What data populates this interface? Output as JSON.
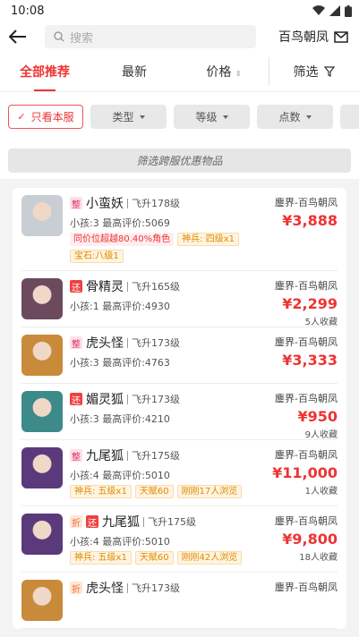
{
  "status": {
    "time": "10:08"
  },
  "header": {
    "search_placeholder": "搜索",
    "server": "百鸟朝凤"
  },
  "tabs": [
    "全部推荐",
    "最新",
    "价格",
    "筛选"
  ],
  "filters": {
    "own_server": "只看本服",
    "dropdowns": [
      "类型",
      "等级",
      "点数"
    ]
  },
  "cross_server": "筛选跨服优惠物品",
  "items": [
    {
      "tags": [
        "整"
      ],
      "name": "小蛮妖",
      "level": "飞升178级",
      "info": "小孩:3 最高评价:5069",
      "badges": [
        {
          "text": "同价位超越80.40%角色",
          "type": "red"
        },
        {
          "text": "神兵: 四级x1",
          "type": "gold"
        },
        {
          "text": "宝石:八级1",
          "type": "gold"
        }
      ],
      "server": "鏖界-百鸟朝凤",
      "price": "¥3,888",
      "fav": "",
      "avatar": "#c9cdd4"
    },
    {
      "tags": [
        "还"
      ],
      "name": "骨精灵",
      "level": "飞升165级",
      "info": "小孩:1 最高评价:4930",
      "badges": [],
      "server": "鏖界-百鸟朝凤",
      "price": "¥2,299",
      "fav": "5人收藏",
      "avatar": "#6a4a5c"
    },
    {
      "tags": [
        "整"
      ],
      "name": "虎头怪",
      "level": "飞升173级",
      "info": "小孩:3 最高评价:4763",
      "badges": [],
      "server": "鏖界-百鸟朝凤",
      "price": "¥3,333",
      "fav": "",
      "avatar": "#c98a3a"
    },
    {
      "tags": [
        "还"
      ],
      "name": "媚灵狐",
      "level": "飞升173级",
      "info": "小孩:3 最高评价:4210",
      "badges": [],
      "server": "鏖界-百鸟朝凤",
      "price": "¥950",
      "fav": "9人收藏",
      "avatar": "#3d8a8a"
    },
    {
      "tags": [
        "整"
      ],
      "name": "九尾狐",
      "level": "飞升175级",
      "info": "小孩:4 最高评价:5010",
      "badges": [
        {
          "text": "神兵: 五级x1",
          "type": "gold"
        },
        {
          "text": "天赋60",
          "type": "gold"
        },
        {
          "text": "刚刚17人浏览",
          "type": "gold"
        }
      ],
      "server": "鏖界-百鸟朝凤",
      "price": "¥11,000",
      "fav": "1人收藏",
      "avatar": "#5a3a7a"
    },
    {
      "tags": [
        "折",
        "还"
      ],
      "name": "九尾狐",
      "level": "飞升175级",
      "info": "小孩:4 最高评价:5010",
      "badges": [
        {
          "text": "神兵: 五级x1",
          "type": "gold"
        },
        {
          "text": "天赋60",
          "type": "gold"
        },
        {
          "text": "刚刚42人浏览",
          "type": "gold"
        }
      ],
      "server": "鏖界-百鸟朝凤",
      "price": "¥9,800",
      "fav": "18人收藏",
      "avatar": "#5a3a7a"
    },
    {
      "tags": [
        "折"
      ],
      "name": "虎头怪",
      "level": "飞升173级",
      "info": "",
      "badges": [],
      "server": "鏖界-百鸟朝凤",
      "price": "",
      "fav": "",
      "avatar": "#c98a3a"
    }
  ]
}
